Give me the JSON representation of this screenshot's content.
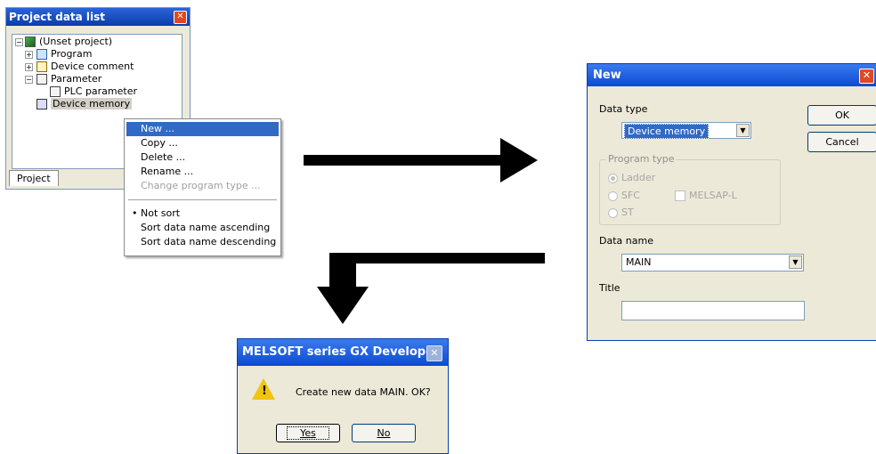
{
  "project_panel": {
    "title": "Project data list",
    "tree": [
      {
        "label": "(Unset project)",
        "icon": "project-icon"
      },
      {
        "label": "Program",
        "icon": "program-icon"
      },
      {
        "label": "Device comment",
        "icon": "device-comment-icon"
      },
      {
        "label": "Parameter",
        "icon": "parameter-icon"
      },
      {
        "label": "PLC parameter",
        "icon": "plc-parameter-icon"
      },
      {
        "label": "Device memory",
        "icon": "device-memory-icon"
      }
    ],
    "tab": "Project"
  },
  "context_menu": {
    "items": [
      "New ...",
      "Copy ...",
      "Delete ...",
      "Rename ...",
      "Change program type ..."
    ],
    "sort_items": [
      "Not sort",
      "Sort data name ascending",
      "Sort data name descending"
    ],
    "selected_sort": "Not sort"
  },
  "new_dialog": {
    "title": "New",
    "data_type_label": "Data type",
    "data_type_value": "Device memory",
    "ok_label": "OK",
    "cancel_label": "Cancel",
    "program_type_label": "Program type",
    "radio_ladder": "Ladder",
    "radio_sfc": "SFC",
    "check_melsap": "MELSAP-L",
    "radio_st": "ST",
    "data_name_label": "Data name",
    "data_name_value": "MAIN",
    "title_label": "Title",
    "title_value": ""
  },
  "confirm_dialog": {
    "title": "MELSOFT series GX Developer",
    "message": "Create new data MAIN. OK?",
    "yes_label": "Yes",
    "no_label": "No"
  },
  "colors": {
    "title_bar": "#0b4bd1",
    "highlight": "#316ac5",
    "dialog_bg": "#ece9d8"
  }
}
